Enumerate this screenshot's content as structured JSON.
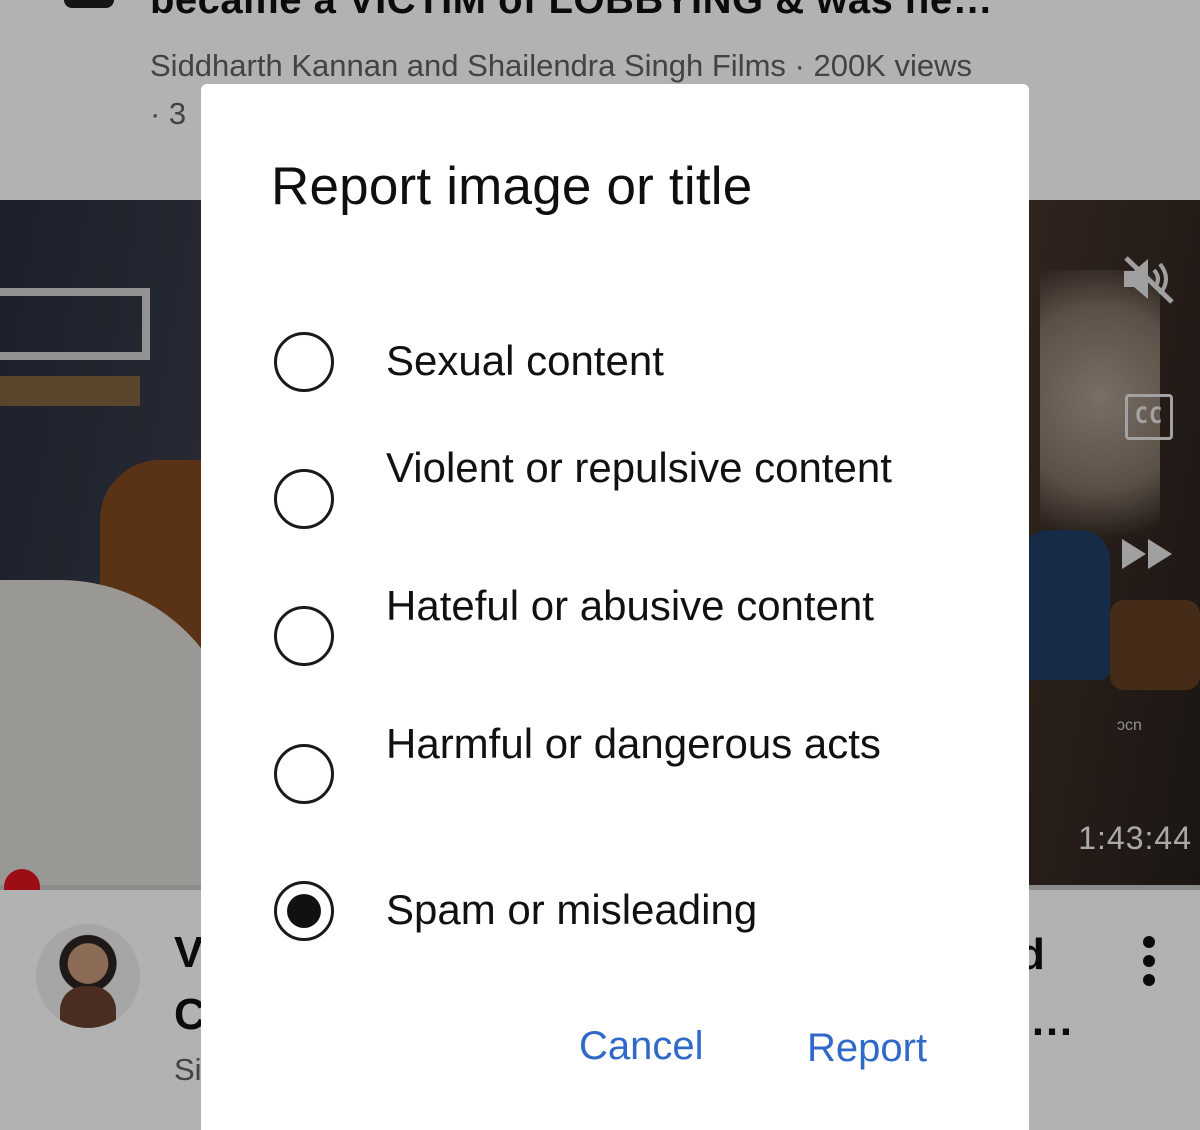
{
  "feed": {
    "top_video": {
      "title": "became a VICTIM of LOBBYING & was he…",
      "meta_line1": "Siddharth Kannan and Shailendra Singh Films · 200K views",
      "meta_line2": "· 3"
    },
    "player": {
      "duration": "1:43:44",
      "cc_label": "CC",
      "logo_text": "Dw",
      "progress": 0.0
    },
    "bottom_video": {
      "title_line1": "V",
      "title_line2": "C",
      "meta": "Si",
      "title_right": "d",
      "title_right_ellipsis": "…"
    }
  },
  "dialog": {
    "title": "Report image or title",
    "options": [
      {
        "label": "Sexual content",
        "checked": false
      },
      {
        "label": "Violent or repulsive content",
        "checked": false
      },
      {
        "label": "Hateful or abusive content",
        "checked": false
      },
      {
        "label": "Harmful or dangerous acts",
        "checked": false
      },
      {
        "label": "Spam or misleading",
        "checked": true
      }
    ],
    "cancel_label": "Cancel",
    "report_label": "Report"
  },
  "colors": {
    "accent": "#2f6ac8",
    "progress": "#e0141e",
    "scrim": "rgba(0,0,0,0.30)"
  },
  "icons": [
    "mute-icon",
    "closed-captions-icon",
    "fast-forward-icon",
    "more-vertical-icon"
  ]
}
